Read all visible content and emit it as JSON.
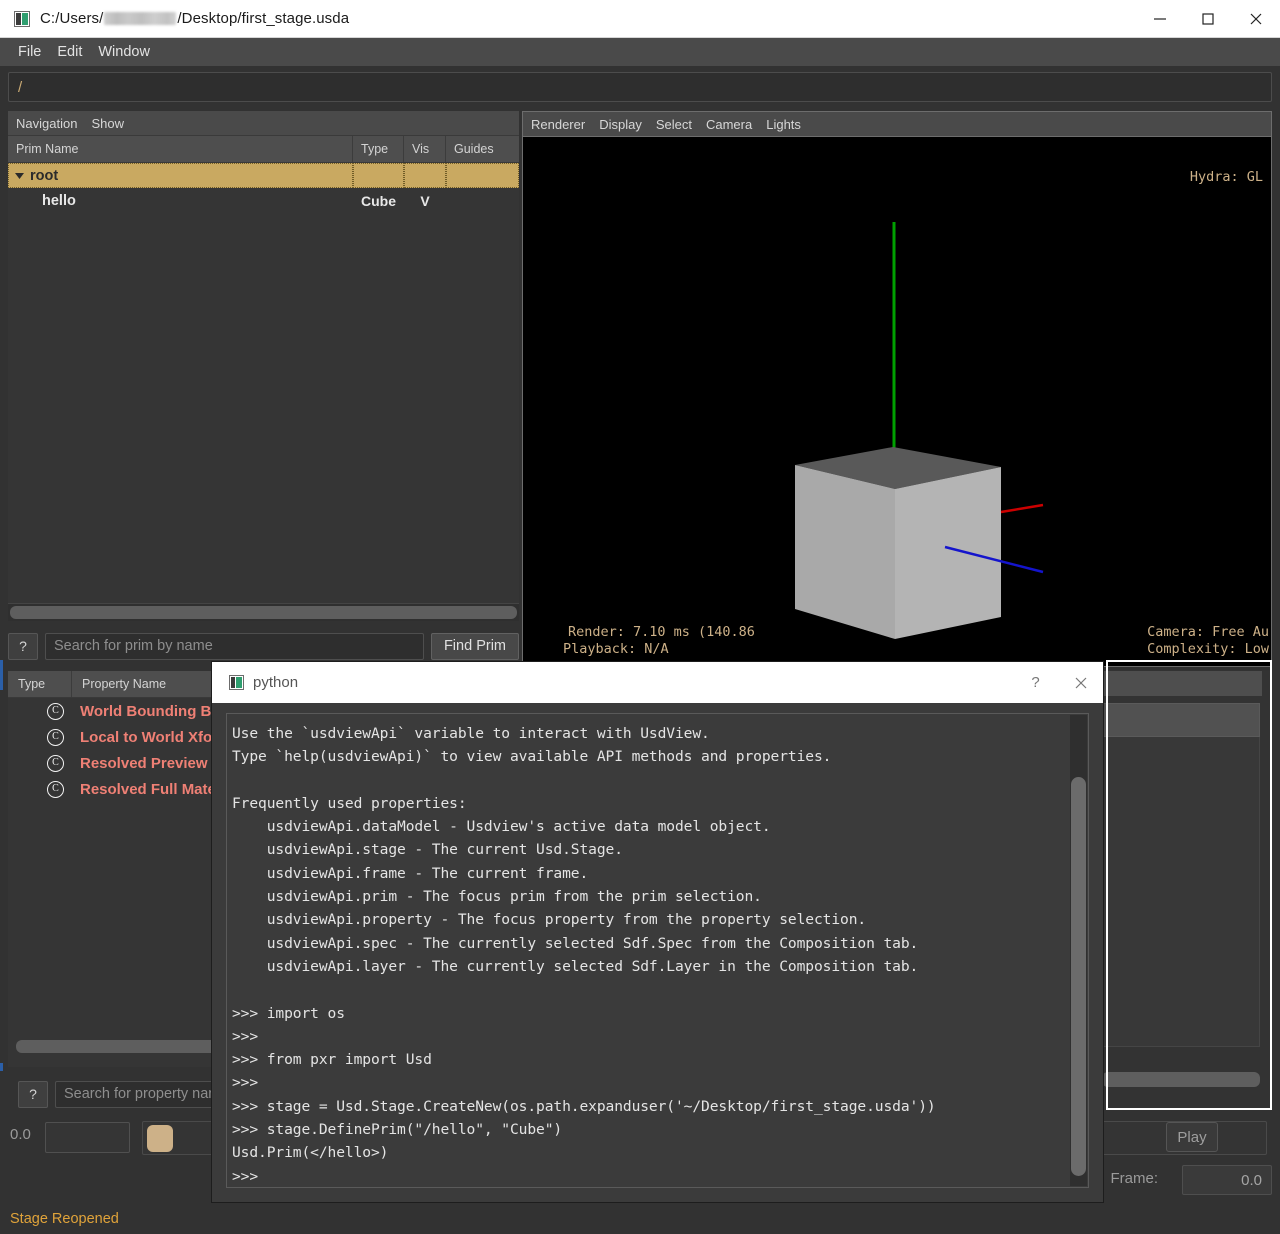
{
  "window": {
    "title_prefix": "C:/Users/",
    "title_suffix": "/Desktop/first_stage.usda",
    "icon": "usdview-icon",
    "minimize": "minimize-icon",
    "maximize": "maximize-icon",
    "close": "close-icon"
  },
  "menubar": {
    "items": [
      {
        "label": "File"
      },
      {
        "label": "Edit"
      },
      {
        "label": "Window"
      }
    ]
  },
  "pathbar": {
    "value": "/"
  },
  "tree_panel": {
    "tabs": [
      {
        "label": "Navigation"
      },
      {
        "label": "Show"
      }
    ],
    "columns": [
      {
        "label": "Prim Name"
      },
      {
        "label": "Type"
      },
      {
        "label": "Vis"
      },
      {
        "label": "Guides"
      }
    ],
    "rows": [
      {
        "name": "root",
        "type": "",
        "vis": "",
        "guides": "",
        "selected": true,
        "expanded": true,
        "depth": 0
      },
      {
        "name": "hello",
        "type": "Cube",
        "vis": "V",
        "guides": "",
        "selected": false,
        "expanded": false,
        "depth": 1
      }
    ]
  },
  "prim_search": {
    "help_label": "?",
    "placeholder": "Search for prim by name",
    "value": "",
    "find_button": "Find Prim"
  },
  "property_panel": {
    "columns": [
      {
        "label": "Type"
      },
      {
        "label": "Property Name"
      }
    ],
    "rows": [
      {
        "icon": "computed-property-icon",
        "name": "World Bounding Box"
      },
      {
        "icon": "computed-property-icon",
        "name": "Local to World Xform"
      },
      {
        "icon": "computed-property-icon",
        "name": "Resolved Preview Material"
      },
      {
        "icon": "computed-property-icon",
        "name": "Resolved Full Material"
      }
    ]
  },
  "property_search": {
    "help_label": "?",
    "placeholder": "Search for property name",
    "value": ""
  },
  "timeline": {
    "start_value": "0.0",
    "play_label": "Play",
    "frame_label": "Frame:",
    "frame_value": "0.0"
  },
  "statusbar": {
    "message": "Stage Reopened",
    "color": "#e0a33a"
  },
  "viewport": {
    "tabs": [
      {
        "label": "Renderer"
      },
      {
        "label": "Display"
      },
      {
        "label": "Select"
      },
      {
        "label": "Camera"
      },
      {
        "label": "Lights"
      }
    ],
    "hud": {
      "hydra": "Hydra: GL",
      "render": "Render: 7.10 ms (140.86",
      "playback": "Playback: N/A",
      "camera": "Camera: Free Au",
      "complexity": "Complexity: Low"
    },
    "scene": {
      "background": "#000000",
      "cube_front": "#b3b3b3",
      "cube_left": "#a8a8a8",
      "cube_top": "#595959",
      "axis_y": "#00a000",
      "axis_x": "#cc0000",
      "axis_z": "#0000d0"
    }
  },
  "python_dialog": {
    "icon": "python-window-icon",
    "title": "python",
    "help_label": "?",
    "close_label": "close-icon",
    "console_text": "Use the `usdviewApi` variable to interact with UsdView.\nType `help(usdviewApi)` to view available API methods and properties.\n\nFrequently used properties:\n    usdviewApi.dataModel - Usdview's active data model object.\n    usdviewApi.stage - The current Usd.Stage.\n    usdviewApi.frame - The current frame.\n    usdviewApi.prim - The focus prim from the prim selection.\n    usdviewApi.property - The focus property from the property selection.\n    usdviewApi.spec - The currently selected Sdf.Spec from the Composition tab.\n    usdviewApi.layer - The currently selected Sdf.Layer in the Composition tab.\n\n>>> import os\n>>>\n>>> from pxr import Usd\n>>>\n>>> stage = Usd.Stage.CreateNew(os.path.expanduser('~/Desktop/first_stage.usda'))\n>>> stage.DefinePrim(\"/hello\", \"Cube\")\nUsd.Prim(</hello>)\n>>>"
  }
}
